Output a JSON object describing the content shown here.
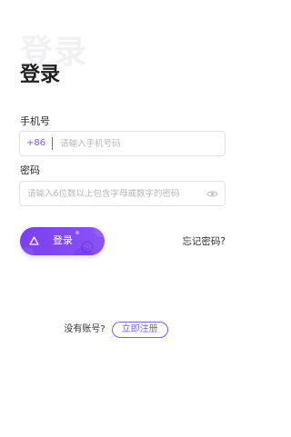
{
  "header": {
    "watermark": "登录",
    "title": "登录"
  },
  "phone": {
    "label": "手机号",
    "country_code": "+86",
    "placeholder": "请输入手机号码",
    "value": ""
  },
  "password": {
    "label": "密码",
    "placeholder": "请输入6位数以上包含字母或数字的密码",
    "value": ""
  },
  "actions": {
    "login_label": "登录",
    "forgot_label": "忘记密码?"
  },
  "footer": {
    "no_account_text": "没有账号?",
    "register_label": "立即注册"
  },
  "colors": {
    "accent": "#7a5af5",
    "button_gradient_start": "#7b3ff2",
    "button_gradient_end": "#8a53f6"
  },
  "icons": {
    "password_visibility": "eye-icon"
  }
}
